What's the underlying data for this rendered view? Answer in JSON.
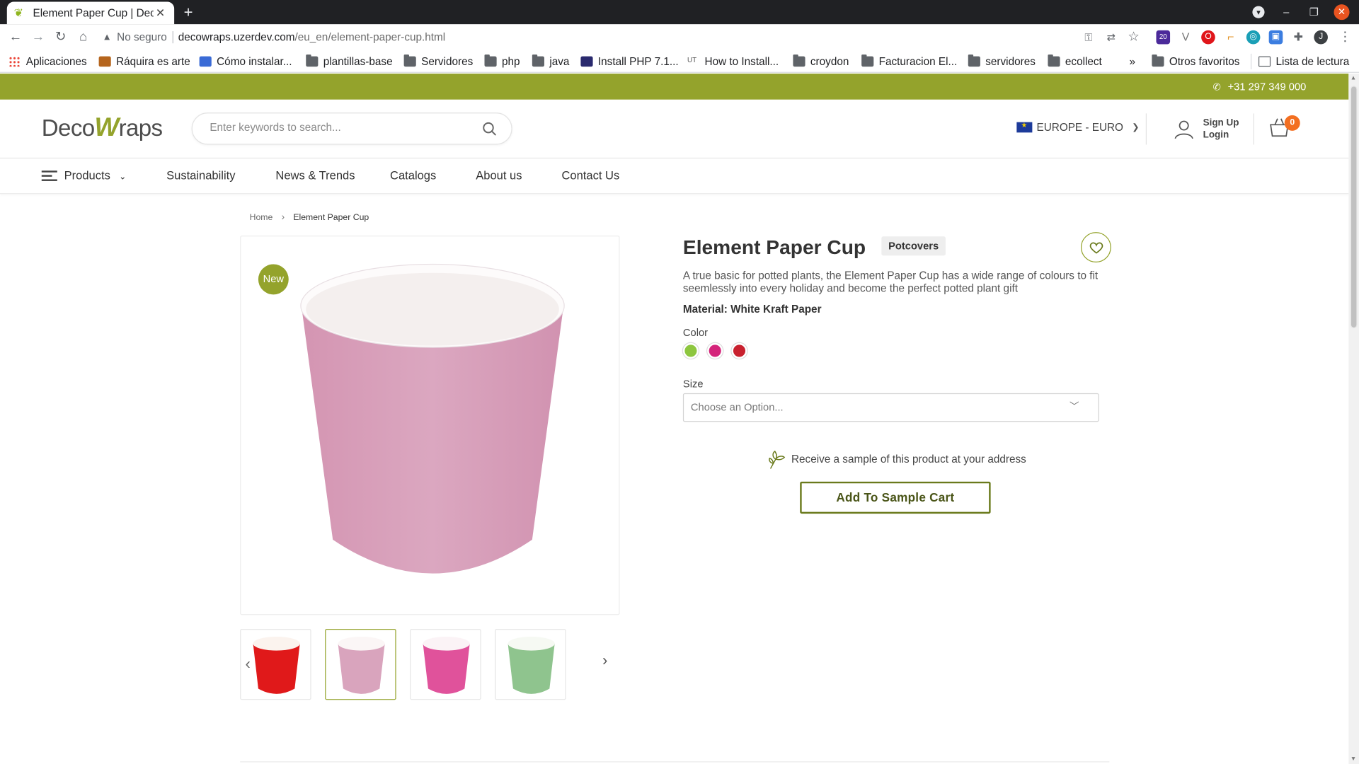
{
  "browser": {
    "tab_title": "Element Paper Cup | Deco",
    "new_tab": "+",
    "url_warning": "No seguro",
    "url_host": "decowraps.uzerdev.com",
    "url_path": "/eu_en/element-paper-cup.html",
    "extension_badge": "20",
    "profile_initial": "J",
    "bookmarks": [
      {
        "label": "Aplicaciones",
        "icon": "apps-grid-icon"
      },
      {
        "label": "Ráquira es arte",
        "icon": "site-icon"
      },
      {
        "label": "Cómo instalar...",
        "icon": "site-icon"
      },
      {
        "label": "plantillas-base",
        "icon": "folder-icon"
      },
      {
        "label": "Servidores",
        "icon": "folder-icon"
      },
      {
        "label": "php",
        "icon": "folder-icon"
      },
      {
        "label": "java",
        "icon": "folder-icon"
      },
      {
        "label": "Install PHP 7.1...",
        "icon": "site-icon"
      },
      {
        "label": "How to Install...",
        "icon": "site-icon"
      },
      {
        "label": "croydon",
        "icon": "folder-icon"
      },
      {
        "label": "Facturacion El...",
        "icon": "folder-icon"
      },
      {
        "label": "servidores",
        "icon": "folder-icon"
      },
      {
        "label": "ecollect",
        "icon": "folder-icon"
      }
    ],
    "bookmarks_more": "»",
    "other_favorites": "Otros favoritos",
    "reading_list": "Lista de lectura"
  },
  "site": {
    "phone": "+31 297 349 000",
    "logo_left": "Deco",
    "logo_w": "W",
    "logo_right": "raps",
    "search_placeholder": "Enter keywords to search...",
    "region": "EUROPE - EURO",
    "sign_up": "Sign Up",
    "login": "Login",
    "cart_count": "0",
    "nav": [
      "Products",
      "Sustainability",
      "News & Trends",
      "Catalogs",
      "About us",
      "Contact Us"
    ]
  },
  "breadcrumb": {
    "home": "Home",
    "current": "Element Paper Cup"
  },
  "product": {
    "badge": "New",
    "title": "Element Paper Cup",
    "tag": "Potcovers",
    "description": "A true basic for potted plants, the Element Paper Cup has a wide range of colours to fit seemlessly into every holiday and become the perfect potted plant gift",
    "material": "Material: White Kraft Paper",
    "color_label": "Color",
    "colors": [
      "#8dc63f",
      "#d4237a",
      "#c8202e"
    ],
    "size_label": "Size",
    "size_placeholder": "Choose an Option...",
    "sample_text": "Receive a sample of this product at your address",
    "sample_button": "Add To Sample Cart",
    "main_image_color": "#d9a4bd",
    "thumbnails": [
      {
        "color": "#e0191a",
        "active": false
      },
      {
        "color": "#d9a4bd",
        "active": true
      },
      {
        "color": "#e0529b",
        "active": false
      },
      {
        "color": "#8fc48e",
        "active": false
      }
    ]
  }
}
